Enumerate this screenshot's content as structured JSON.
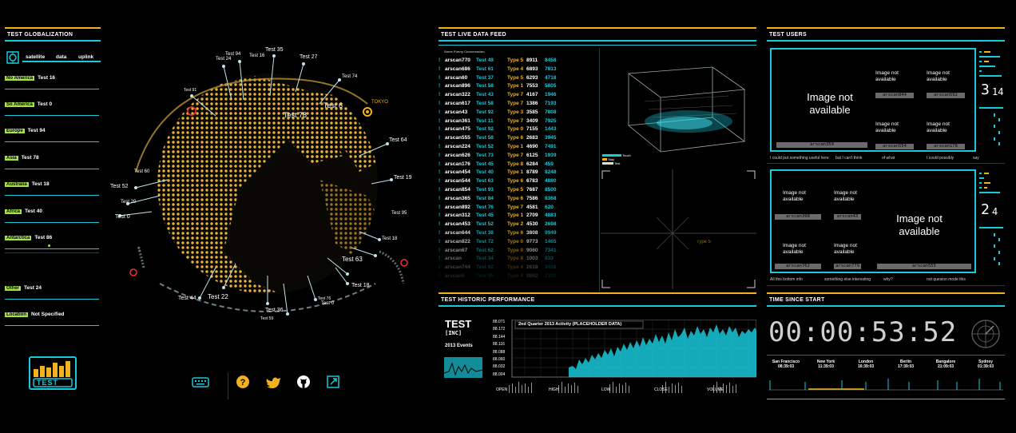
{
  "globalization": {
    "title": "TEST GLOBALIZATION",
    "tabs": [
      "satellite",
      "data",
      "uplink"
    ],
    "regions": [
      {
        "tag": "No America",
        "value": "Test 16"
      },
      {
        "tag": "So America",
        "value": "Test 0"
      },
      {
        "tag": "Europe",
        "value": "Test 94"
      },
      {
        "tag": "Asia",
        "value": "Test 78"
      },
      {
        "tag": "Australia",
        "value": "Test 18"
      },
      {
        "tag": "Africa",
        "value": "Test 40"
      },
      {
        "tag": "Antarctica",
        "value": "Test 86"
      }
    ],
    "other": {
      "tag": "Other",
      "value": "Test 24"
    },
    "location": {
      "tag": "Location",
      "value": "Not Specified"
    },
    "logo_text": "TEST"
  },
  "globe": {
    "labels": [
      "Test 35",
      "Test 94",
      "Test 24",
      "Test 16",
      "Test 27",
      "Test 74",
      "Test 91",
      "TOKYO",
      "Test 6",
      "Test 78",
      "Test 64",
      "Test 60",
      "Test 19",
      "Test 52",
      "Test 20",
      "Test 95",
      "Test 0",
      "Test 18",
      "Test 63",
      "Test 18",
      "Test 44",
      "Test 22",
      "Test 76",
      "Test 0",
      "Test 36",
      "Test 59"
    ]
  },
  "footer_icons": [
    "keyboard-icon",
    "help-icon",
    "twitter-icon",
    "github-icon",
    "fullscreen-icon"
  ],
  "feed": {
    "title": "TEST LIVE DATA FEED",
    "subtitle": "Some Funny Conversation",
    "rows": [
      [
        "arscan770",
        "Test 49",
        "Type 5",
        "8911",
        "8458"
      ],
      [
        "arscan686",
        "Test 61",
        "Type 4",
        "6893",
        "7813"
      ],
      [
        "arscan60",
        "Test 37",
        "Type 5",
        "6293",
        "4718"
      ],
      [
        "arscan896",
        "Test 58",
        "Type 1",
        "7553",
        "5805"
      ],
      [
        "arscan322",
        "Test 43",
        "Type 7",
        "4167",
        "1946"
      ],
      [
        "arscan617",
        "Test 58",
        "Type 7",
        "1386",
        "7193"
      ],
      [
        "arscan43",
        "Test 92",
        "Type 3",
        "3585",
        "7808"
      ],
      [
        "arscan361",
        "Test 11",
        "Type 7",
        "3409",
        "7925"
      ],
      [
        "arscan475",
        "Test 92",
        "Type 0",
        "7155",
        "1443"
      ],
      [
        "arscan555",
        "Test 58",
        "Type 6",
        "2683",
        "3945"
      ],
      [
        "arscan224",
        "Test 52",
        "Type 1",
        "4690",
        "7491"
      ],
      [
        "arscan626",
        "Test 73",
        "Type 7",
        "6125",
        "1939"
      ],
      [
        "arscan176",
        "Test 45",
        "Type 8",
        "6284",
        "459"
      ],
      [
        "arscan454",
        "Test 40",
        "Type 1",
        "8789",
        "8248"
      ],
      [
        "arscan544",
        "Test 63",
        "Type 6",
        "6783",
        "4880"
      ],
      [
        "arscan854",
        "Test 93",
        "Type 5",
        "7687",
        "8500"
      ],
      [
        "arscan365",
        "Test 84",
        "Type 6",
        "7586",
        "8368"
      ],
      [
        "arscan892",
        "Test 76",
        "Type 7",
        "4581",
        "620"
      ],
      [
        "arscan312",
        "Test 45",
        "Type 1",
        "2709",
        "4883"
      ],
      [
        "arscan453",
        "Test 52",
        "Type 2",
        "4530",
        "2698"
      ],
      [
        "arscan644",
        "Test 38",
        "Type 6",
        "3808",
        "9949"
      ],
      [
        "arscan822",
        "Test 72",
        "Type 0",
        "9773",
        "1465"
      ],
      [
        "arscan67",
        "Test 62",
        "Type 0",
        "9060",
        "7341"
      ],
      [
        "arscan",
        "Test 34",
        "Type 8",
        "1003",
        "833"
      ],
      [
        "arscan744",
        "Test 62",
        "Type 4",
        "2618",
        "3416"
      ],
      [
        "arscan5",
        "Test 95",
        "Type 4",
        "9862",
        "7391"
      ]
    ],
    "legend": [
      "Touch",
      "Stay",
      "Test"
    ],
    "crosshair_label": "Type 5"
  },
  "users": {
    "title": "TEST USERS",
    "image_na": "Image not available",
    "panel1": {
      "main_name": "arscan359",
      "names": [
        "arscan844",
        "arscan592",
        "arscan554",
        "arscan178"
      ],
      "captions": [
        "I could put something useful here",
        "but I can't think",
        "of what",
        "I could possibly",
        "say"
      ],
      "month": "3",
      "day": "14"
    },
    "panel2": {
      "main_name": "arscan555",
      "names": [
        "arscan398",
        "arscan43",
        "arscan762",
        "arscan779"
      ],
      "captions": [
        "All this bottom info",
        "something else interesting",
        "why?",
        "not quesion mode this"
      ],
      "month": "2",
      "day": "4"
    }
  },
  "historic": {
    "title": "TEST HISTORIC PERFORMANCE",
    "logo_line1": "TEST",
    "logo_line2": "[INC]",
    "logo_line3": "2013 Events",
    "chart_title": "2nd Quarter 2013 Activity (PLACEHOLDER DATA)",
    "y_ticks": [
      "88.071",
      "88.172",
      "88.144",
      "88.116",
      "88.088",
      "88.060",
      "88.032",
      "88.004"
    ],
    "bottom_labels": [
      "OPEN",
      "HIGH",
      "LOW",
      "CLOSE",
      "VOLUME"
    ]
  },
  "time": {
    "title": "TIME SINCE START",
    "value": "00:00:53:52",
    "cities": [
      {
        "name": "San Francisco",
        "time": "08:39:03"
      },
      {
        "name": "New York",
        "time": "11:39:03"
      },
      {
        "name": "London",
        "time": "16:39:03"
      },
      {
        "name": "Berlin",
        "time": "17:39:03"
      },
      {
        "name": "Bangalore",
        "time": "21:09:03"
      },
      {
        "name": "Sydney",
        "time": "01:39:03"
      }
    ]
  },
  "colors": {
    "cyan": "#19c8d9",
    "yellow": "#f2b21d",
    "green": "#a6e04a"
  }
}
